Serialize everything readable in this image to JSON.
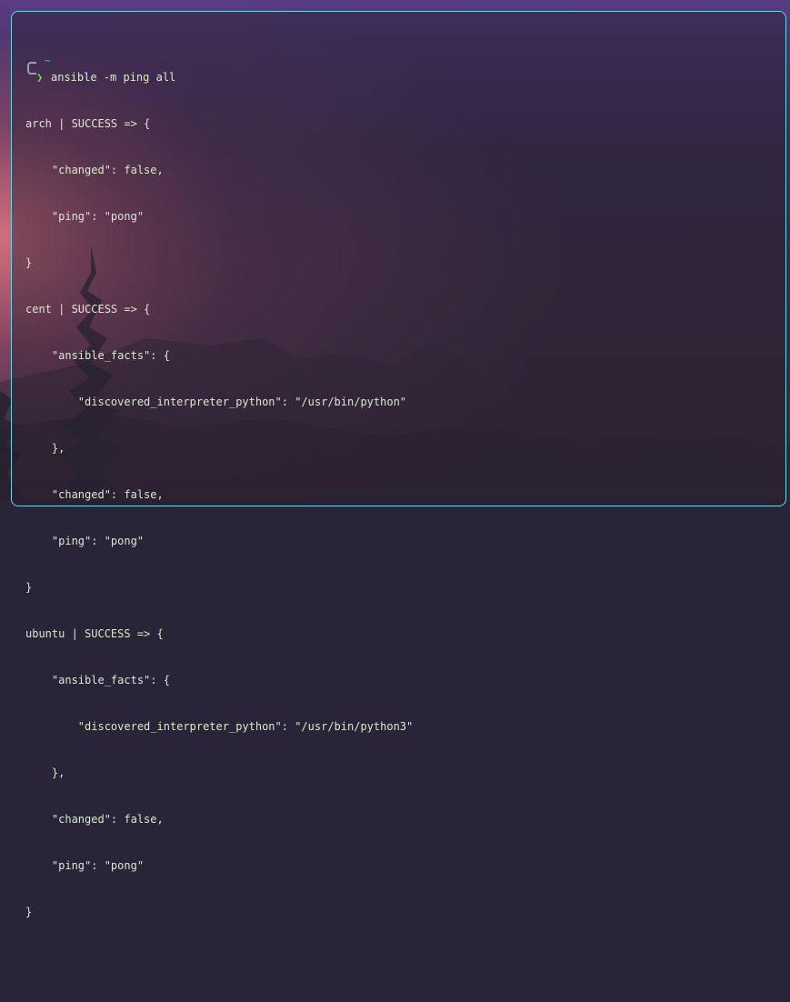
{
  "terminal": {
    "prompt_symbol": "❯",
    "cwd": "~",
    "command": "ansible -m ping all",
    "output_lines": [
      "arch | SUCCESS => {",
      "    \"changed\": false,",
      "    \"ping\": \"pong\"",
      "}",
      "cent | SUCCESS => {",
      "    \"ansible_facts\": {",
      "        \"discovered_interpreter_python\": \"/usr/bin/python\"",
      "    },",
      "    \"changed\": false,",
      "    \"ping\": \"pong\"",
      "}",
      "ubuntu | SUCCESS => {",
      "    \"ansible_facts\": {",
      "        \"discovered_interpreter_python\": \"/usr/bin/python3\"",
      "    },",
      "    \"changed\": false,",
      "    \"ping\": \"pong\"",
      "}"
    ],
    "next_prompt_cwd": "~",
    "colors": {
      "border": "#6fd2e2",
      "prompt_arrow": "#7fd142",
      "cwd": "#4fb8e6",
      "text": "#d9e8cc"
    }
  }
}
